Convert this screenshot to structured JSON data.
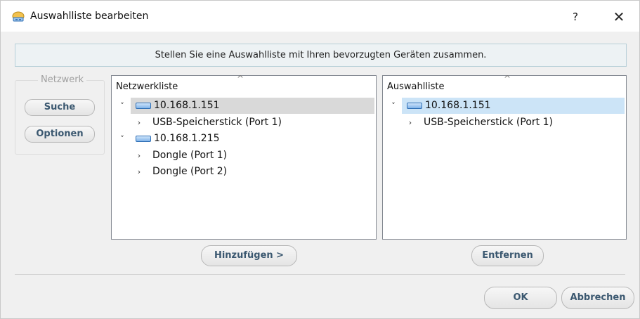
{
  "window": {
    "title": "Auswahlliste bearbeiten",
    "help_label": "?",
    "close_label": "✕"
  },
  "info": {
    "text": "Stellen Sie eine Auswahlliste mit Ihren bevorzugten Geräten zusammen."
  },
  "network_group": {
    "legend": "Netzwerk",
    "search_label": "Suche",
    "options_label": "Optionen"
  },
  "network_list": {
    "header": "Netzwerkliste",
    "sort_indicator": "^",
    "items": [
      {
        "label": "10.168.1.151",
        "expander": "˅",
        "type": "device",
        "level": 0,
        "selected": true
      },
      {
        "label": "USB-Speicherstick (Port 1)",
        "expander": "›",
        "type": "port",
        "level": 1,
        "selected": false
      },
      {
        "label": "10.168.1.215",
        "expander": "˅",
        "type": "device",
        "level": 0,
        "selected": false
      },
      {
        "label": "Dongle (Port 1)",
        "expander": "›",
        "type": "port",
        "level": 1,
        "selected": false
      },
      {
        "label": "Dongle (Port 2)",
        "expander": "›",
        "type": "port",
        "level": 1,
        "selected": false
      }
    ]
  },
  "selection_list": {
    "header": "Auswahlliste",
    "sort_indicator": "^",
    "items": [
      {
        "label": "10.168.1.151",
        "expander": "˅",
        "type": "device",
        "level": 0,
        "selected": true
      },
      {
        "label": "USB-Speicherstick (Port 1)",
        "expander": "›",
        "type": "port",
        "level": 1,
        "selected": false
      }
    ]
  },
  "actions": {
    "add_label": "Hinzufügen >",
    "remove_label": "Entfernen"
  },
  "footer": {
    "ok_label": "OK",
    "cancel_label": "Abbrechen"
  },
  "colors": {
    "accent_text": "#3b5870",
    "selection_grey": "#d9d9d9",
    "selection_blue": "#cce4f7",
    "device_icon": "#2f6fb5"
  },
  "icons": {
    "app": "network-tray-icon",
    "device": "network-device-icon"
  }
}
